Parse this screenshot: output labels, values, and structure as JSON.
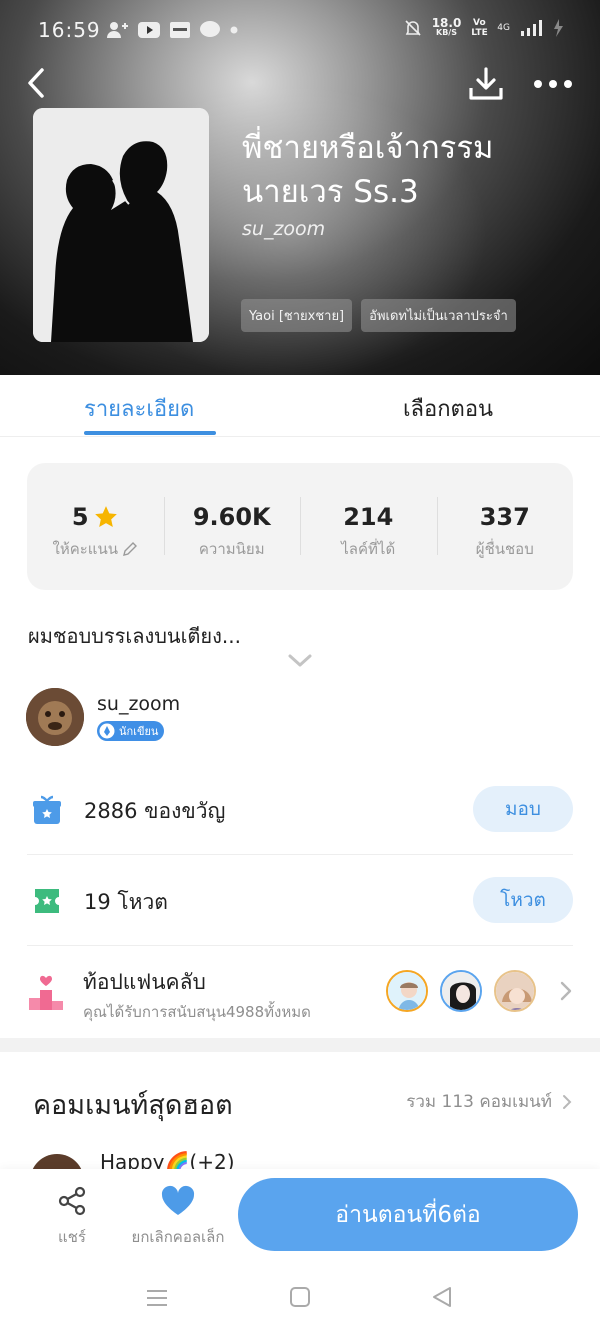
{
  "status_bar": {
    "time": "16:59",
    "net_speed_value": "18.0",
    "net_speed_unit": "KB/S",
    "network_labels": "Vo LTE",
    "network_type": "4G"
  },
  "book": {
    "title": "พี่ชายหรือเจ้ากรรมนายเวร Ss.3",
    "author": "su_zoom",
    "tags": [
      "Yaoi [ชายxชาย]",
      "อัพเดทไม่เป็นเวลาประจำ"
    ]
  },
  "tabs": [
    {
      "label": "รายละเอียด",
      "active": true
    },
    {
      "label": "เลือกตอน",
      "active": false
    }
  ],
  "stats": [
    {
      "value": "5",
      "label": "ให้คะแนน",
      "icon": "star-icon"
    },
    {
      "value": "9.60K",
      "label": "ความนิยม"
    },
    {
      "value": "214",
      "label": "ไลค์ที่ได้"
    },
    {
      "value": "337",
      "label": "ผู้ชื่นชอบ"
    }
  ],
  "synopsis": "ผมชอบบรรเลงบนเตียง...",
  "author_card": {
    "name": "su_zoom",
    "badge": "นักเขียน"
  },
  "gifts": {
    "text": "2886 ของขวัญ",
    "button": "มอบ"
  },
  "votes": {
    "text": "19 โหวต",
    "button": "โหวต"
  },
  "fanclub": {
    "title": "ท้อปแฟนคลับ",
    "subtitle": "คุณได้รับการสนับสนุน4988ทั้งหมด"
  },
  "hot_comments": {
    "title": "คอมเมนท์สุดฮอต",
    "total": "รวม 113 คอมเมนท์",
    "first_commenter": "Happy🌈(+2)"
  },
  "bottom_bar": {
    "share_label": "แชร์",
    "like_label": "ยกเลิกคอลเล็ก",
    "read_button": "อ่านตอนที่6ต่อ"
  },
  "colors": {
    "accent": "#3d8fe0",
    "read_button": "#5aa4ee",
    "pill_bg": "#e4f0fb",
    "gift_icon": "#4d9be8",
    "vote_icon": "#3dbb7e",
    "fanclub_icon": "#f06a92",
    "star": "#f7b500"
  }
}
